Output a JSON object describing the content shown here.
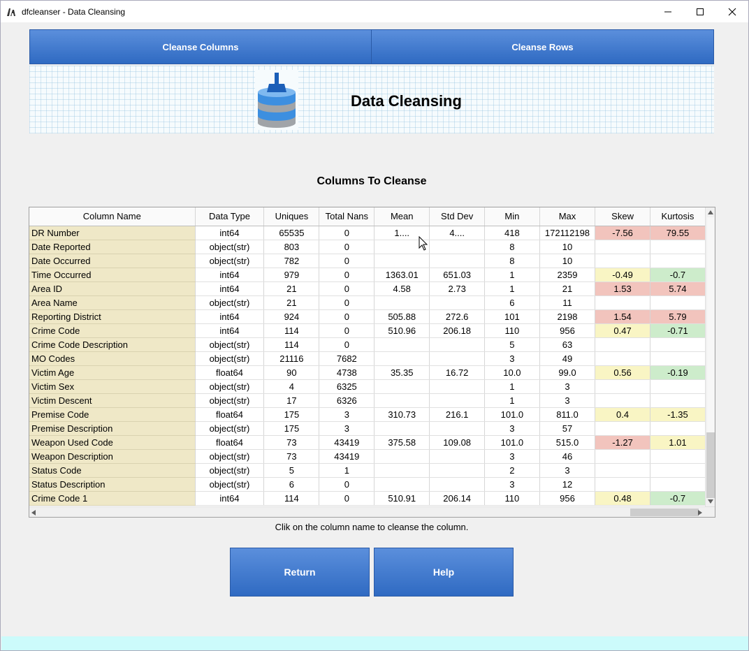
{
  "window": {
    "title": "dfcleanser - Data Cleansing"
  },
  "nav": {
    "cleanse_columns": "Cleanse Columns",
    "cleanse_rows": "Cleanse Rows"
  },
  "banner": {
    "heading": "Data Cleansing"
  },
  "section": {
    "title": "Columns To Cleanse"
  },
  "table": {
    "columns": [
      "Column Name",
      "Data Type",
      "Uniques",
      "Total Nans",
      "Mean",
      "Std Dev",
      "Min",
      "Max",
      "Skew",
      "Kurtosis"
    ],
    "rows": [
      [
        "DR Number",
        "int64",
        "65535",
        "0",
        "1....",
        "4....",
        "418",
        "172112198",
        "-7.56",
        "79.55"
      ],
      [
        "Date Reported",
        "object(str)",
        "803",
        "0",
        "",
        "",
        "8",
        "10",
        "",
        ""
      ],
      [
        "Date Occurred",
        "object(str)",
        "782",
        "0",
        "",
        "",
        "8",
        "10",
        "",
        ""
      ],
      [
        "Time Occurred",
        "int64",
        "979",
        "0",
        "1363.01",
        "651.03",
        "1",
        "2359",
        "-0.49",
        "-0.7"
      ],
      [
        "Area ID",
        "int64",
        "21",
        "0",
        "4.58",
        "2.73",
        "1",
        "21",
        "1.53",
        "5.74"
      ],
      [
        "Area Name",
        "object(str)",
        "21",
        "0",
        "",
        "",
        "6",
        "11",
        "",
        ""
      ],
      [
        "Reporting District",
        "int64",
        "924",
        "0",
        "505.88",
        "272.6",
        "101",
        "2198",
        "1.54",
        "5.79"
      ],
      [
        "Crime Code",
        "int64",
        "114",
        "0",
        "510.96",
        "206.18",
        "110",
        "956",
        "0.47",
        "-0.71"
      ],
      [
        "Crime Code Description",
        "object(str)",
        "114",
        "0",
        "",
        "",
        "5",
        "63",
        "",
        ""
      ],
      [
        "MO Codes",
        "object(str)",
        "21116",
        "7682",
        "",
        "",
        "3",
        "49",
        "",
        ""
      ],
      [
        "Victim Age",
        "float64",
        "90",
        "4738",
        "35.35",
        "16.72",
        "10.0",
        "99.0",
        "0.56",
        "-0.19"
      ],
      [
        "Victim Sex",
        "object(str)",
        "4",
        "6325",
        "",
        "",
        "1",
        "3",
        "",
        ""
      ],
      [
        "Victim Descent",
        "object(str)",
        "17",
        "6326",
        "",
        "",
        "1",
        "3",
        "",
        ""
      ],
      [
        "Premise Code",
        "float64",
        "175",
        "3",
        "310.73",
        "216.1",
        "101.0",
        "811.0",
        "0.4",
        "-1.35"
      ],
      [
        "Premise Description",
        "object(str)",
        "175",
        "3",
        "",
        "",
        "3",
        "57",
        "",
        ""
      ],
      [
        "Weapon Used Code",
        "float64",
        "73",
        "43419",
        "375.58",
        "109.08",
        "101.0",
        "515.0",
        "-1.27",
        "1.01"
      ],
      [
        "Weapon Description",
        "object(str)",
        "73",
        "43419",
        "",
        "",
        "3",
        "46",
        "",
        ""
      ],
      [
        "Status Code",
        "object(str)",
        "5",
        "1",
        "",
        "",
        "2",
        "3",
        "",
        ""
      ],
      [
        "Status Description",
        "object(str)",
        "6",
        "0",
        "",
        "",
        "3",
        "12",
        "",
        ""
      ],
      [
        "Crime Code 1",
        "int64",
        "114",
        "0",
        "510.91",
        "206.14",
        "110",
        "956",
        "0.48",
        "-0.7"
      ]
    ],
    "cell_colors": {
      "DR Number": [
        "red",
        "red"
      ],
      "Time Occurred": [
        "yellow",
        "green"
      ],
      "Area ID": [
        "red",
        "red"
      ],
      "Reporting District": [
        "red",
        "red"
      ],
      "Crime Code": [
        "yellow",
        "green"
      ],
      "Victim Age": [
        "yellow",
        "green"
      ],
      "Premise Code": [
        "yellow",
        "yellow"
      ],
      "Weapon Used Code": [
        "red",
        "yellow"
      ],
      "Crime Code 1": [
        "yellow",
        "green"
      ]
    }
  },
  "hint": "Clik on the column name to cleanse the column.",
  "buttons": {
    "return": "Return",
    "help": "Help"
  },
  "colors": {
    "button_top": "#5b8fdc",
    "button_bottom": "#2f6ac2",
    "name_cell": "#efe8c7",
    "red": "#f2c4bd",
    "yellow": "#f9f5c4",
    "green": "#cdeccb",
    "footer": "#ccfbfb"
  }
}
